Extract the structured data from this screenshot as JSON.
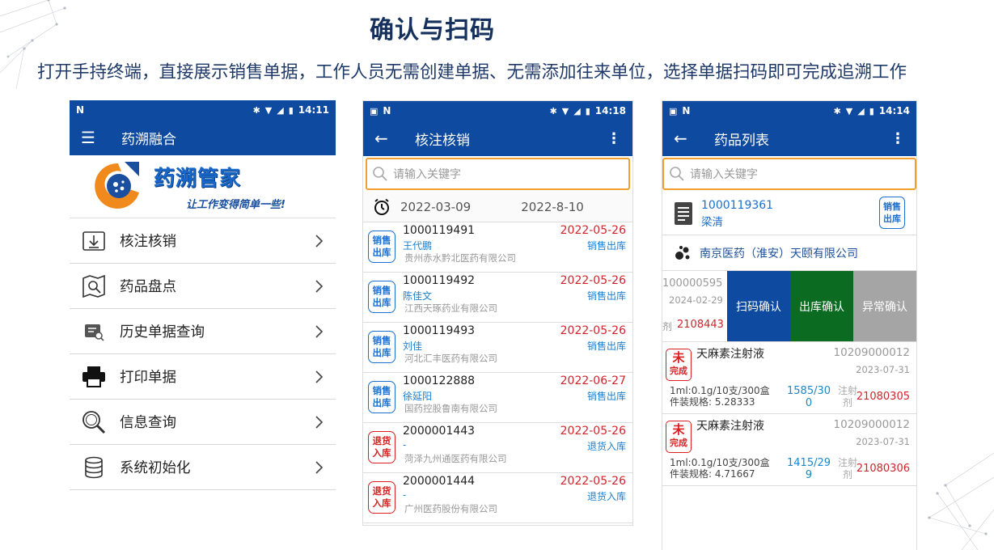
{
  "header": {
    "title": "确认与扫码",
    "subtitle": "打开手持终端，直接展示销售单据，工作人员无需创建单据、无需添加往来单位，选择单据扫码即可完成追溯工作"
  },
  "colors": {
    "primary": "#0d4aa0",
    "accent_orange": "#f0a030",
    "red": "#d0242a",
    "green": "#0b6b20",
    "grey": "#a5a5a5"
  },
  "phone1": {
    "status": {
      "left": "N",
      "time": "14:11"
    },
    "appbar": {
      "nav_icon": "hamburger-icon",
      "title": "药溯融合"
    },
    "logo": {
      "text": "药溯管家",
      "slogan": "让工作变得简单一些!"
    },
    "menu": [
      {
        "label": "核注核销",
        "icon": "download-box-icon"
      },
      {
        "label": "药品盘点",
        "icon": "map-search-icon"
      },
      {
        "label": "历史单据查询",
        "icon": "doc-search-icon"
      },
      {
        "label": "打印单据",
        "icon": "printer-icon"
      },
      {
        "label": "信息查询",
        "icon": "magnifier-icon"
      },
      {
        "label": "系统初始化",
        "icon": "database-icon"
      }
    ]
  },
  "phone2": {
    "status": {
      "left": "N",
      "time": "14:18"
    },
    "appbar": {
      "title": "核注核销"
    },
    "search": {
      "placeholder": "请输入关键字"
    },
    "date_from": "2022-03-09",
    "date_to": "2022-8-10",
    "orders": [
      {
        "badge": [
          "销售",
          "出库"
        ],
        "badge_color": "blue",
        "no": "1000119491",
        "name": "王代鹏",
        "company": "贵州赤水黔北医药有限公司",
        "date": "2022-05-26",
        "type": "销售出库"
      },
      {
        "badge": [
          "销售",
          "出库"
        ],
        "badge_color": "blue",
        "no": "1000119492",
        "name": "陈佳文",
        "company": "江西天琢药业有限公司",
        "date": "2022-05-26",
        "type": "销售出库"
      },
      {
        "badge": [
          "销售",
          "出库"
        ],
        "badge_color": "blue",
        "no": "1000119493",
        "name": "刘佳",
        "company": "河北汇丰医药有限公司",
        "date": "2022-05-26",
        "type": "销售出库"
      },
      {
        "badge": [
          "销售",
          "出库"
        ],
        "badge_color": "blue",
        "no": "1000122888",
        "name": "徐延阳",
        "company": "国药控股鲁南有限公司",
        "date": "2022-06-27",
        "type": "销售出库"
      },
      {
        "badge": [
          "退货",
          "入库"
        ],
        "badge_color": "red",
        "no": "2000001443",
        "name": "-",
        "company": "菏泽九州通医药有限公司",
        "date": "2022-05-26",
        "type": "退货入库"
      },
      {
        "badge": [
          "退货",
          "入库"
        ],
        "badge_color": "red",
        "no": "2000001444",
        "name": "-",
        "company": "广州医药股份有限公司",
        "date": "2022-05-26",
        "type": "退货入库"
      }
    ]
  },
  "phone3": {
    "status": {
      "left": "N",
      "time": "14:14"
    },
    "appbar": {
      "title": "药品列表"
    },
    "search": {
      "placeholder": "请输入关键字"
    },
    "order": {
      "no": "1000119361",
      "person": "梁清",
      "badge": [
        "销售",
        "出库"
      ]
    },
    "company": "南京医药（淮安）天颐有限公司",
    "swipe_row": {
      "no": "100000595",
      "date": "2024-02-29",
      "label": "剂",
      "batch": "2108443"
    },
    "actions": [
      "扫码确认",
      "出库确认",
      "异常确认"
    ],
    "drugs": [
      {
        "status": [
          "未",
          "完成"
        ],
        "name": "天麻素注射液",
        "code": "10209000012",
        "date": "2023-07-31",
        "spec1": "1ml:0.1g/10支/300盒",
        "spec2": "件装规格: 5.28333",
        "qty1": "1585/30",
        "qty2": "0",
        "lbl1": "注射",
        "lbl2": "剂",
        "batch": "21080305"
      },
      {
        "status": [
          "未",
          "完成"
        ],
        "name": "天麻素注射液",
        "code": "10209000012",
        "date": "2023-07-31",
        "spec1": "1ml:0.1g/10支/300盒",
        "spec2": "件装规格: 4.71667",
        "qty1": "1415/29",
        "qty2": "9",
        "lbl1": "注射",
        "lbl2": "剂",
        "batch": "21080306"
      }
    ]
  }
}
